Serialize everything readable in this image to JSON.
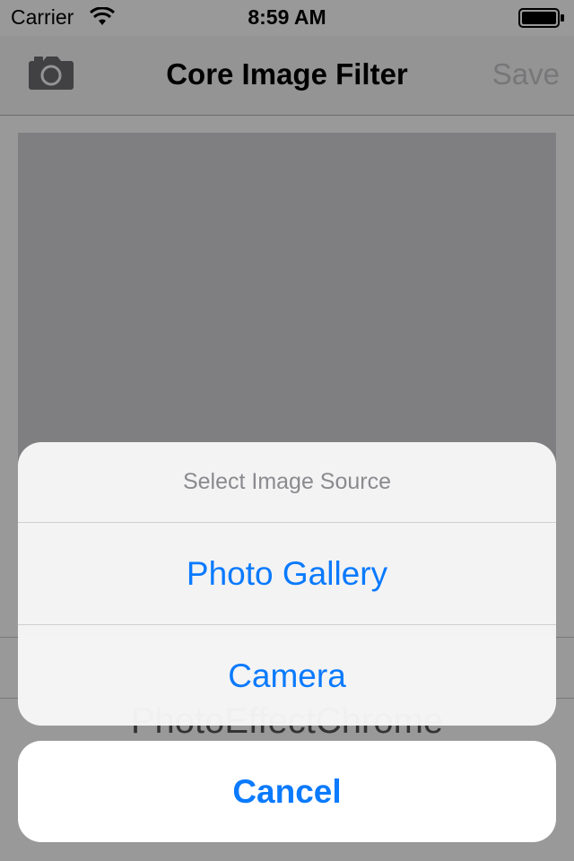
{
  "status_bar": {
    "carrier": "Carrier",
    "time": "8:59 AM",
    "wifi_icon": "wifi-icon",
    "battery_icon": "battery-icon"
  },
  "nav": {
    "camera_icon": "camera-icon",
    "title": "Core Image Filter",
    "save_label": "Save"
  },
  "content": {
    "filter_name": "PhotoEffectChrome"
  },
  "action_sheet": {
    "title": "Select Image Source",
    "items": [
      {
        "label": "Photo Gallery"
      },
      {
        "label": "Camera"
      }
    ],
    "cancel_label": "Cancel"
  },
  "colors": {
    "accent": "#0a7aff",
    "disabled": "#c7c7cc",
    "header_text": "#8a8a8f"
  }
}
